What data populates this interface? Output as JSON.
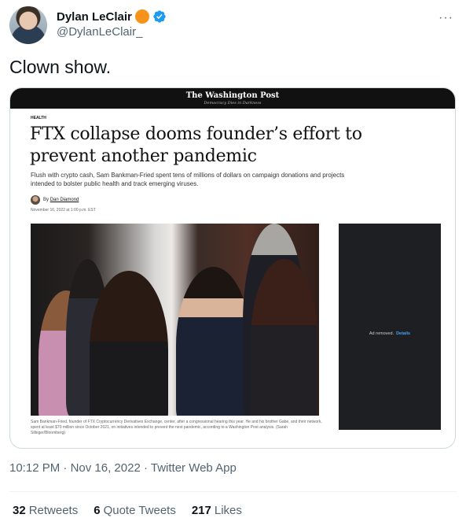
{
  "author": {
    "display_name": "Dylan LeClair",
    "handle": "@DylanLeClair_",
    "badge_color": "#f7931a",
    "verified_color": "#1d9bf0"
  },
  "more_label": "···",
  "tweet_text": "Clown show.",
  "article": {
    "publication": "The Washington Post",
    "tagline": "Democracy Dies in Darkness",
    "section": "HEALTH",
    "headline": "FTX collapse dooms founder’s effort to prevent another pandemic",
    "dek": "Flush with crypto cash, Sam Bankman-Fried spent tens of millions of dollars on campaign donations and projects intended to bolster public health and track emerging viruses.",
    "byline_prefix": "By",
    "byline_author": "Dan Diamond",
    "dateline": "November 16, 2022 at 1:00 p.m. EST",
    "caption": "Sam Bankman-Fried, founder of FTX Cryptocurrency Derivatives Exchange, center, after a congressional hearing this year. He and his brother Gabe, and their network, spent at least $70 million since October 2021, on initiatives intended to prevent the next pandemic, according to a Washington Post analysis. (Sarah Silbiger/Bloomberg)",
    "ad_text": "Ad removed.",
    "ad_link": "Details"
  },
  "meta": {
    "time": "10:12 PM",
    "date": "Nov 16, 2022",
    "app": "Twitter Web App",
    "separator": " · "
  },
  "stats": {
    "retweets_count": "32",
    "retweets_label": "Retweets",
    "quotes_count": "6",
    "quotes_label": "Quote Tweets",
    "likes_count": "217",
    "likes_label": "Likes"
  }
}
